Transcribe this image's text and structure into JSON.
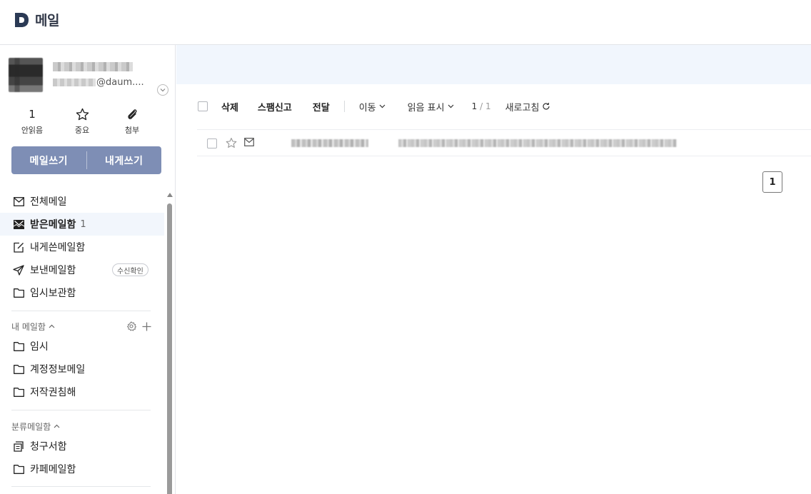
{
  "app": {
    "logo_text": "메일",
    "brand_color": "#2b3a55"
  },
  "profile": {
    "email_suffix": "@daum...."
  },
  "quick": {
    "unread": {
      "count": "1",
      "label": "안읽음"
    },
    "important": {
      "label": "중요",
      "icon": "star-icon"
    },
    "attachment": {
      "label": "첨부",
      "icon": "paperclip-icon"
    }
  },
  "write": {
    "compose_label": "메일쓰기",
    "self_label": "내게쓰기",
    "bg_color": "#7e8eb5"
  },
  "nav": [
    {
      "label": "전체메일",
      "icon": "mail-icon"
    },
    {
      "label": "받은메일함",
      "icon": "inbox-icon",
      "count": "1",
      "active": true
    },
    {
      "label": "내게쓴메일함",
      "icon": "edit-icon"
    },
    {
      "label": "보낸메일함",
      "icon": "send-icon",
      "badge": "수신확인"
    },
    {
      "label": "임시보관함",
      "icon": "folder-icon"
    }
  ],
  "my_mailbox": {
    "title": "내 메일함",
    "folders": [
      "임시",
      "계정정보메일",
      "저작권침해"
    ]
  },
  "category": {
    "title": "분류메일함",
    "folders": [
      {
        "label": "청구서함",
        "icon": "receipt-icon"
      },
      {
        "label": "카페메일함",
        "icon": "folder-icon"
      }
    ]
  },
  "toolbar": {
    "delete": "삭제",
    "spam": "스팸신고",
    "forward": "전달",
    "move": "이동",
    "mark_read": "읽음 표시",
    "page_current": "1",
    "page_sep": "/",
    "page_total": "1",
    "refresh": "새로고침"
  },
  "pagination": {
    "current": "1"
  }
}
